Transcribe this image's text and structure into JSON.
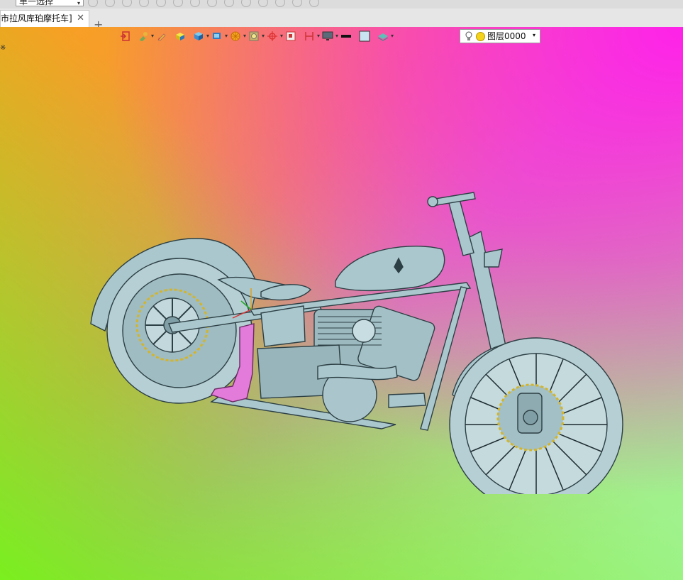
{
  "selection_mode": "单一选择",
  "tab": {
    "title": "市拉风库珀摩托车]",
    "close_glyph": "✕"
  },
  "add_tab_glyph": "+",
  "layer": {
    "name": "图层0000"
  },
  "left_glyph": "※",
  "colors": {
    "part_color": "#a9c7cd",
    "highlight_part": "#e27bd9",
    "bg_magenta": "#f22ce6",
    "bg_green": "#7af01e",
    "bg_orange": "#f7a021"
  },
  "toolbar_icons": [
    "exit-icon",
    "paint-tool-icon",
    "pencil-icon",
    "box-yellow-icon",
    "cube-blue-icon",
    "cube-display-icon",
    "sphere-render-icon",
    "view-frame-icon",
    "crosshair-icon",
    "small-view-icon",
    "section-view-icon",
    "monitor-icon",
    "line-color-icon",
    "fill-color-icon",
    "layer-stack-icon"
  ]
}
